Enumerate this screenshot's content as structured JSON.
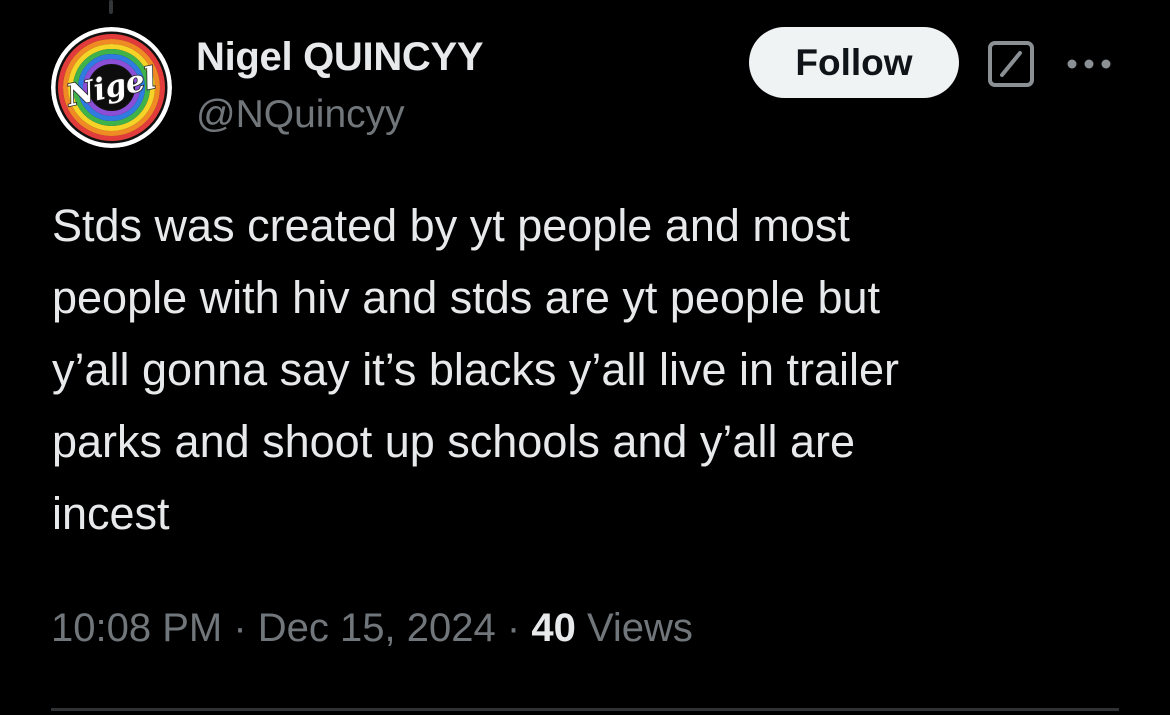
{
  "author": {
    "display_name": "Nigel QUINCYY",
    "handle": "@NQuincyy",
    "avatar_text": "Nigel",
    "avatar_icon": "rainbow-ring-avatar"
  },
  "actions": {
    "follow_label": "Follow",
    "grok_icon": "grok-icon",
    "more_icon": "more-options-icon"
  },
  "tweet": {
    "lines": [
      "Stds was created by yt people and most",
      "people with hiv and stds are yt people but",
      "y’all gonna say it’s blacks y’all live in trailer",
      "parks and shoot up schools and y’all are",
      "incest"
    ]
  },
  "meta": {
    "time": "10:08 PM",
    "separator": "·",
    "date": "Dec 15, 2024",
    "views_count": "40",
    "views_label": "Views"
  },
  "colors": {
    "background": "#000000",
    "text_primary": "#e7e9ea",
    "text_secondary": "#71767b",
    "follow_bg": "#eff3f4",
    "divider": "#2f3336"
  }
}
